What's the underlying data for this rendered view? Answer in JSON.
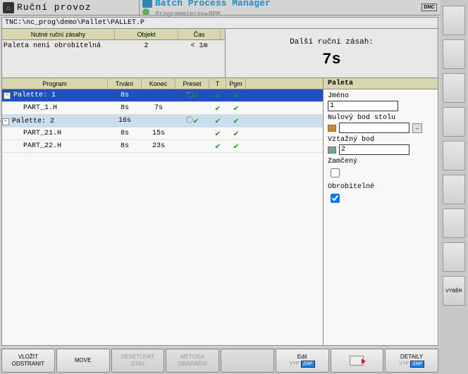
{
  "header": {
    "mode": "Ruční provoz",
    "app_title": "Batch Process Manager",
    "breadcrumb": "Programmieren▸BPM",
    "dnc": "DNC"
  },
  "path": "TNC:\\nc_prog\\demo\\Pallet\\PALLET.P",
  "interventions": {
    "headers": {
      "intervention": "Nutné ruční zásahy",
      "object": "Objekt",
      "time": "Čas"
    },
    "rows": [
      {
        "text": "Paleta není obrobitelná",
        "object": "2",
        "time": "< 1m"
      }
    ]
  },
  "next_intervention": {
    "label": "Další ruční zásah:",
    "value": "7s"
  },
  "program_table": {
    "headers": {
      "program": "Program",
      "trvani": "Trvání",
      "konec": "Konec",
      "preset": "Preset",
      "t": "T",
      "pgm": "Pgm"
    },
    "rows": [
      {
        "kind": "palette",
        "selected": true,
        "name": "Palette: 1",
        "trvani": "8s",
        "konec": "",
        "preset_icon": "target",
        "t": true,
        "pgm": true
      },
      {
        "kind": "part",
        "name": "PART_1.H",
        "trvani": "8s",
        "konec": "7s",
        "preset_icon": "",
        "t": true,
        "pgm": true
      },
      {
        "kind": "palette",
        "alt": true,
        "tagged": true,
        "name": "Palette: 2",
        "trvani": "16s",
        "konec": "",
        "preset_icon": "target-dim",
        "t": true,
        "pgm": true
      },
      {
        "kind": "part",
        "name": "PART_21.H",
        "trvani": "8s",
        "konec": "15s",
        "preset_icon": "",
        "t": true,
        "pgm": true
      },
      {
        "kind": "part",
        "name": "PART_22.H",
        "trvani": "8s",
        "konec": "23s",
        "preset_icon": "",
        "t": true,
        "pgm": true
      }
    ]
  },
  "right_panel": {
    "title": "Paleta",
    "fields": {
      "jmeno_label": "Jméno",
      "jmeno_value": "1",
      "stolu_label": "Nulový bod stolu",
      "stolu_value": "",
      "vztazny_label": "Vztažný bod",
      "vztazny_value": "2",
      "zamceny_label": "Zamčený",
      "zamceny_checked": false,
      "obrobitelne_label": "Obrobitelné",
      "obrobitelne_checked": true
    }
  },
  "softkeys": {
    "k1a": "VLOŽIT",
    "k1b": "ODSTRANIT",
    "k2": "MOVE",
    "k3a": "RESETOVAT",
    "k3b": "STAV",
    "k4a": "METODA",
    "k4b": "OBRÁBĚNÍ",
    "k5": "",
    "k6a": "Edit",
    "k6off": "VYP",
    "k6on": "ZAP",
    "k7": "",
    "k8a": "DETAILY",
    "k8off": "VYP",
    "k8on": "ZAP"
  },
  "vyber": "VÝBĚR"
}
